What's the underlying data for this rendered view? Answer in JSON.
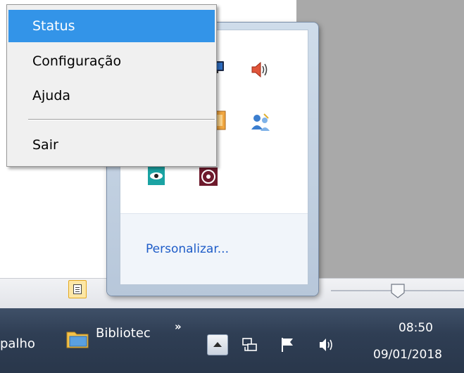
{
  "context_menu": {
    "items": [
      {
        "label": "Status",
        "highlighted": true
      },
      {
        "label": "Configuração",
        "highlighted": false
      },
      {
        "label": "Ajuda",
        "highlighted": false
      },
      {
        "label": "Sair",
        "highlighted": false
      }
    ],
    "highlight_color": "#3394e8"
  },
  "flyout": {
    "customize_link": "Personalizar...",
    "icons": [
      "monitor-icon",
      "speaker-icon",
      "app-orange-icon",
      "users-network-icon",
      "eye-icon",
      "target-icon"
    ]
  },
  "taskbar": {
    "prev_button_text": "palho",
    "library_button_text": "Bibliotec",
    "overflow_chevron": "»",
    "clock_time": "08:50",
    "clock_date": "09/01/2018",
    "tray_icons": [
      "show-hidden-icons-icon",
      "network-icon",
      "action-center-flag-icon",
      "volume-icon"
    ]
  },
  "colors": {
    "taskbar": "#2f3e54",
    "link": "#1e5cc8"
  }
}
